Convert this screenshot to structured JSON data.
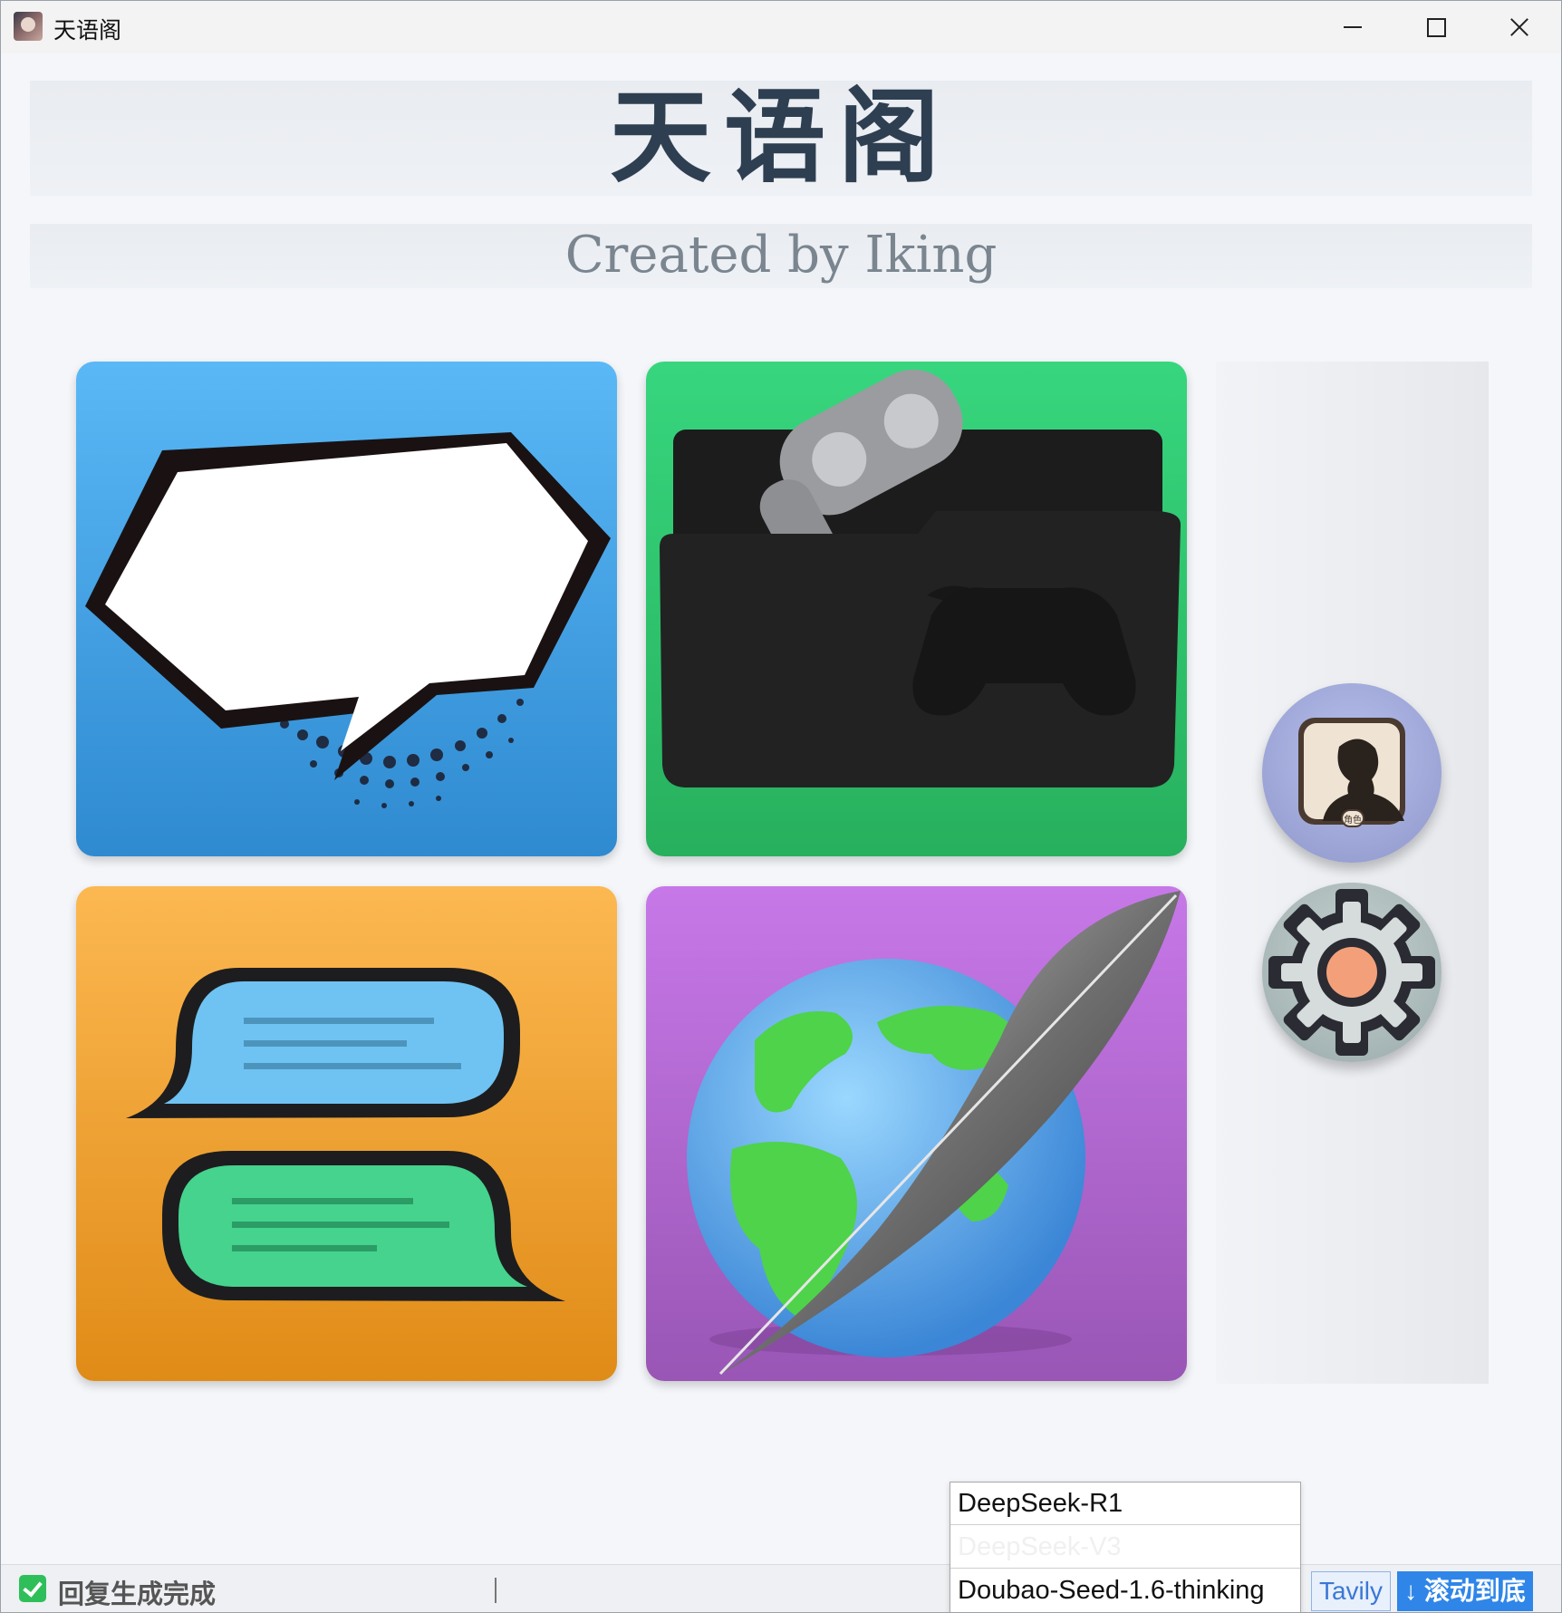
{
  "window": {
    "title": "天语阁",
    "app_icon": "avatar-app-icon",
    "controls": [
      "minimize-icon",
      "maximize-icon",
      "close-icon"
    ]
  },
  "header": {
    "title": "天语阁",
    "subtitle": "Created by Iking"
  },
  "tiles": [
    {
      "icon": "comic-speech-bubble-icon",
      "color": "#4ca8ec"
    },
    {
      "icon": "game-controller-folder-icon",
      "color": "#33c671"
    },
    {
      "icon": "chat-bubbles-icon",
      "color": "#f3a434"
    },
    {
      "icon": "globe-quill-icon",
      "color": "#b46bd3"
    }
  ],
  "side_buttons": [
    {
      "icon": "role-portrait-icon",
      "badge": "角色"
    },
    {
      "icon": "gear-icon"
    }
  ],
  "status": {
    "text": "回复生成完成",
    "check_color": "#2fbf5a"
  },
  "model_dropdown": {
    "options": [
      "DeepSeek-R1",
      "DeepSeek-V3",
      "Doubao-Seed-1.6-thinking"
    ]
  },
  "buttons": {
    "tavily": "Tavily",
    "scroll_bottom": "↓ 滚动到底"
  }
}
